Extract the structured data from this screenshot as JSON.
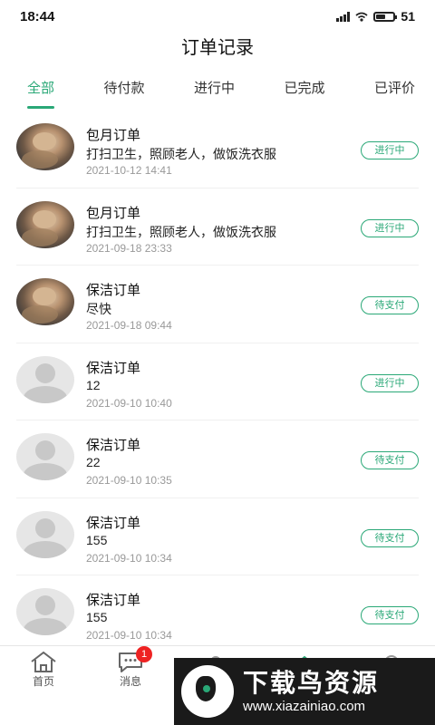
{
  "status_bar": {
    "time": "18:44",
    "battery_level": "51",
    "battery_fraction": 0.51
  },
  "header": {
    "title": "订单记录"
  },
  "tabs": [
    {
      "label": "全部",
      "active": true
    },
    {
      "label": "待付款",
      "active": false
    },
    {
      "label": "进行中",
      "active": false
    },
    {
      "label": "已完成",
      "active": false
    },
    {
      "label": "已评价",
      "active": false
    }
  ],
  "orders": [
    {
      "type": "包月订单",
      "desc": "打扫卫生，照顾老人，做饭洗衣服",
      "time": "2021-10-12 14:41",
      "status": "进行中",
      "avatar": "photo"
    },
    {
      "type": "包月订单",
      "desc": "打扫卫生，照顾老人，做饭洗衣服",
      "time": "2021-09-18 23:33",
      "status": "进行中",
      "avatar": "photo"
    },
    {
      "type": "保洁订单",
      "desc": "尽快",
      "time": "2021-09-18 09:44",
      "status": "待支付",
      "avatar": "photo"
    },
    {
      "type": "保洁订单",
      "desc": "12",
      "time": "2021-09-10 10:40",
      "status": "进行中",
      "avatar": "placeholder"
    },
    {
      "type": "保洁订单",
      "desc": "22",
      "time": "2021-09-10 10:35",
      "status": "待支付",
      "avatar": "placeholder"
    },
    {
      "type": "保洁订单",
      "desc": "155",
      "time": "2021-09-10 10:34",
      "status": "待支付",
      "avatar": "placeholder"
    },
    {
      "type": "保洁订单",
      "desc": "155",
      "time": "2021-09-10 10:34",
      "status": "待支付",
      "avatar": "placeholder"
    }
  ],
  "bottom_nav": {
    "home": {
      "label": "首页",
      "icon": "home-icon"
    },
    "messages": {
      "label": "消息",
      "icon": "chat-icon",
      "badge": "1"
    }
  },
  "watermark": {
    "title": "下载鸟资源",
    "url": "www.xiazainiao.com"
  },
  "colors": {
    "accent": "#2aa877",
    "badge": "#ee2222"
  }
}
